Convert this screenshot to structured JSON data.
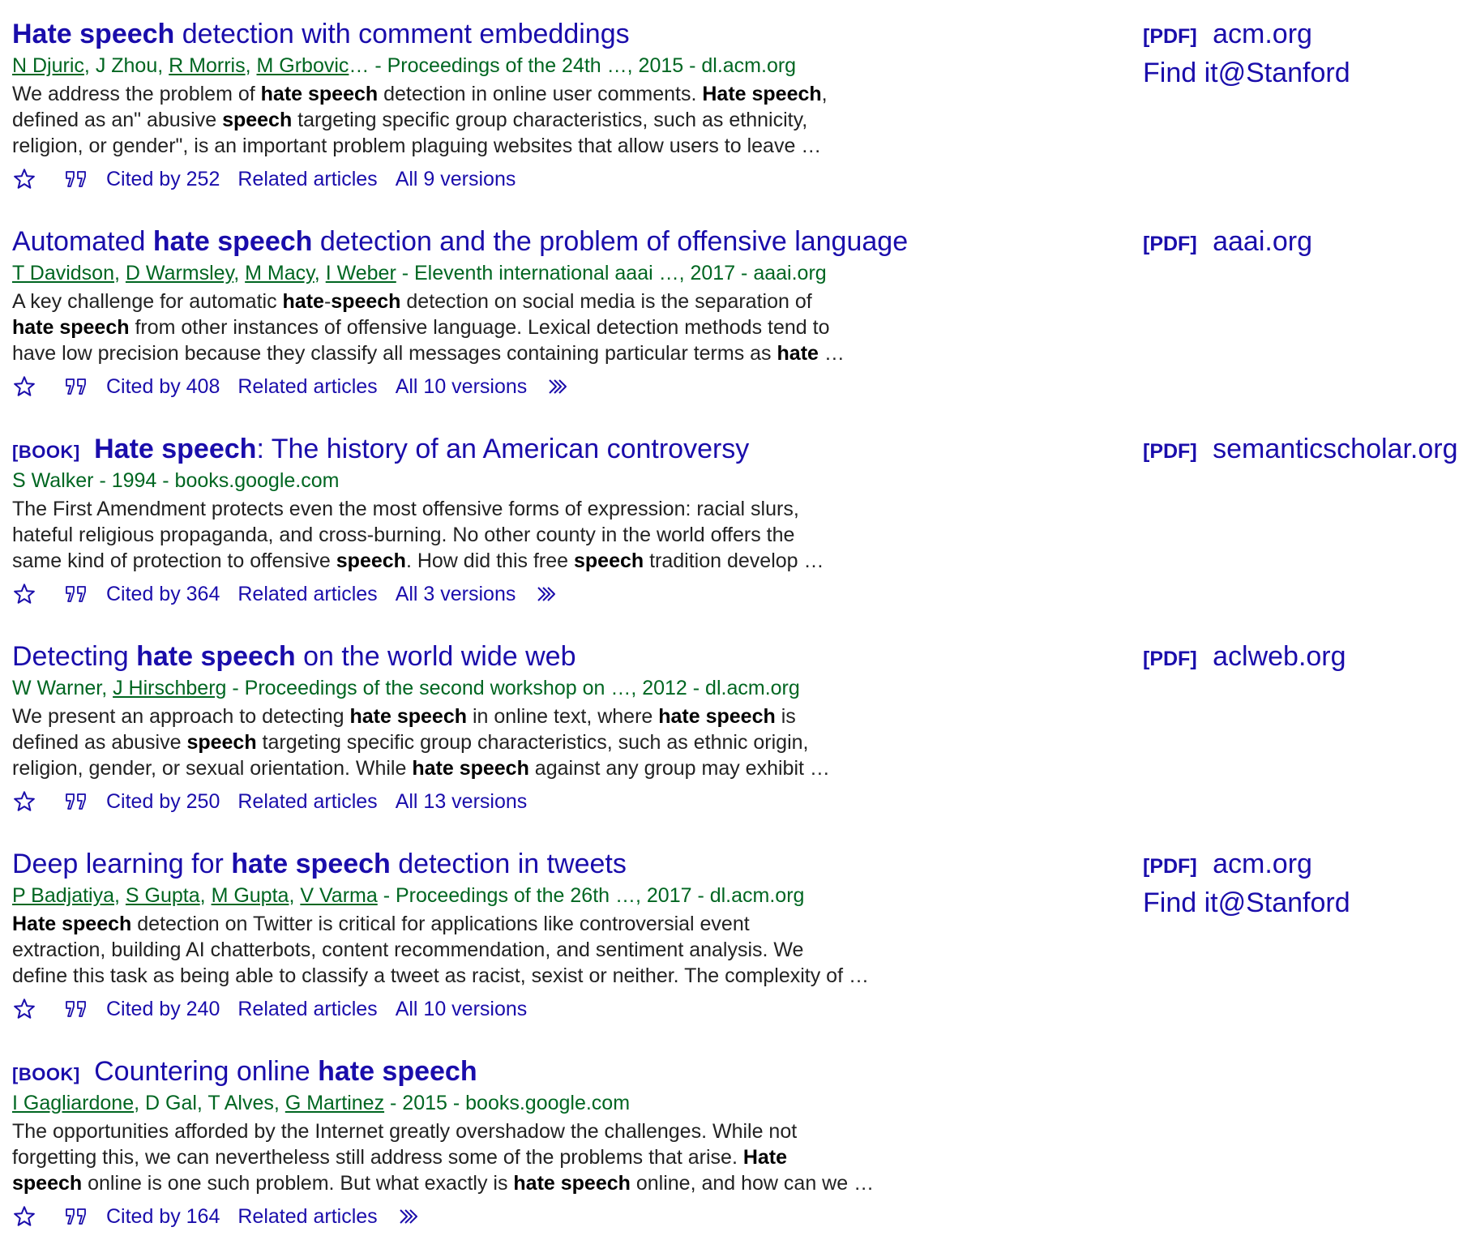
{
  "results": [
    {
      "type_tag": "",
      "title_segments": [
        {
          "text": "Hate speech",
          "bold": true
        },
        {
          "text": " detection with comment embeddings",
          "bold": false
        }
      ],
      "authors": [
        {
          "name": "N Djuric",
          "link": true
        },
        {
          "name": "J Zhou",
          "link": false
        },
        {
          "name": "R Morris",
          "link": true
        },
        {
          "name": "M Grbovic",
          "link": true
        }
      ],
      "authors_ellipsis": "…",
      "source": " - Proceedings of the 24th …, 2015 - dl.acm.org",
      "snippet_lines": [
        [
          {
            "text": "We address the problem of ",
            "bold": false
          },
          {
            "text": "hate speech",
            "bold": true
          },
          {
            "text": " detection in online user comments. ",
            "bold": false
          },
          {
            "text": "Hate speech",
            "bold": true
          },
          {
            "text": ",",
            "bold": false
          }
        ],
        [
          {
            "text": "defined as an\" abusive ",
            "bold": false
          },
          {
            "text": "speech",
            "bold": true
          },
          {
            "text": " targeting specific group characteristics, such as ethnicity,",
            "bold": false
          }
        ],
        [
          {
            "text": "religion, or gender\", is an important problem plaguing websites that allow users to leave …",
            "bold": false
          }
        ]
      ],
      "cited_by": "Cited by 252",
      "related": "Related articles",
      "versions": "All 9 versions",
      "has_more": false,
      "side": {
        "pdf_tag": "[PDF]",
        "domain": "acm.org",
        "findit": "Find it@Stanford"
      }
    },
    {
      "type_tag": "",
      "title_segments": [
        {
          "text": "Automated ",
          "bold": false
        },
        {
          "text": "hate speech",
          "bold": true
        },
        {
          "text": " detection and the problem of offensive language",
          "bold": false
        }
      ],
      "authors": [
        {
          "name": "T Davidson",
          "link": true
        },
        {
          "name": "D Warmsley",
          "link": true
        },
        {
          "name": "M Macy",
          "link": true
        },
        {
          "name": "I Weber",
          "link": true
        }
      ],
      "authors_ellipsis": "",
      "source": " - Eleventh international aaai …, 2017 - aaai.org",
      "snippet_lines": [
        [
          {
            "text": "A key challenge for automatic ",
            "bold": false
          },
          {
            "text": "hate",
            "bold": true
          },
          {
            "text": "-",
            "bold": false
          },
          {
            "text": "speech",
            "bold": true
          },
          {
            "text": " detection on social media is the separation of",
            "bold": false
          }
        ],
        [
          {
            "text": "hate speech",
            "bold": true
          },
          {
            "text": " from other instances of offensive language. Lexical detection methods tend to",
            "bold": false
          }
        ],
        [
          {
            "text": "have low precision because they classify all messages containing particular terms as ",
            "bold": false
          },
          {
            "text": "hate",
            "bold": true
          },
          {
            "text": "  …",
            "bold": false
          }
        ]
      ],
      "cited_by": "Cited by 408",
      "related": "Related articles",
      "versions": "All 10 versions",
      "has_more": true,
      "side": {
        "pdf_tag": "[PDF]",
        "domain": "aaai.org",
        "findit": ""
      }
    },
    {
      "type_tag": "[BOOK]",
      "title_segments": [
        {
          "text": "Hate speech",
          "bold": true
        },
        {
          "text": ": The history of an American controversy",
          "bold": false
        }
      ],
      "authors": [
        {
          "name": "S Walker",
          "link": false
        }
      ],
      "authors_ellipsis": "",
      "source": " - 1994 - books.google.com",
      "snippet_lines": [
        [
          {
            "text": "The First Amendment protects even the most offensive forms of expression: racial slurs,",
            "bold": false
          }
        ],
        [
          {
            "text": "hateful religious propaganda, and cross-burning. No other county in the world offers the",
            "bold": false
          }
        ],
        [
          {
            "text": "same kind of protection to offensive ",
            "bold": false
          },
          {
            "text": "speech",
            "bold": true
          },
          {
            "text": ". How did this free ",
            "bold": false
          },
          {
            "text": "speech",
            "bold": true
          },
          {
            "text": " tradition develop …",
            "bold": false
          }
        ]
      ],
      "cited_by": "Cited by 364",
      "related": "Related articles",
      "versions": "All 3 versions",
      "has_more": true,
      "side": {
        "pdf_tag": "[PDF]",
        "domain": "semanticscholar.org",
        "findit": ""
      }
    },
    {
      "type_tag": "",
      "title_segments": [
        {
          "text": "Detecting ",
          "bold": false
        },
        {
          "text": "hate speech",
          "bold": true
        },
        {
          "text": " on the world wide web",
          "bold": false
        }
      ],
      "authors": [
        {
          "name": "W Warner",
          "link": false
        },
        {
          "name": "J Hirschberg",
          "link": true
        }
      ],
      "authors_ellipsis": "",
      "source": " - Proceedings of the second workshop on …, 2012 - dl.acm.org",
      "snippet_lines": [
        [
          {
            "text": "We present an approach to detecting ",
            "bold": false
          },
          {
            "text": "hate speech",
            "bold": true
          },
          {
            "text": " in online text, where ",
            "bold": false
          },
          {
            "text": "hate speech",
            "bold": true
          },
          {
            "text": " is",
            "bold": false
          }
        ],
        [
          {
            "text": "defined as abusive ",
            "bold": false
          },
          {
            "text": "speech",
            "bold": true
          },
          {
            "text": " targeting specific group characteristics, such as ethnic origin,",
            "bold": false
          }
        ],
        [
          {
            "text": "religion, gender, or sexual orientation. While ",
            "bold": false
          },
          {
            "text": "hate speech",
            "bold": true
          },
          {
            "text": " against any group may exhibit …",
            "bold": false
          }
        ]
      ],
      "cited_by": "Cited by 250",
      "related": "Related articles",
      "versions": "All 13 versions",
      "has_more": false,
      "side": {
        "pdf_tag": "[PDF]",
        "domain": "aclweb.org",
        "findit": ""
      }
    },
    {
      "type_tag": "",
      "title_segments": [
        {
          "text": "Deep learning for ",
          "bold": false
        },
        {
          "text": "hate speech",
          "bold": true
        },
        {
          "text": " detection in tweets",
          "bold": false
        }
      ],
      "authors": [
        {
          "name": "P Badjatiya",
          "link": true
        },
        {
          "name": "S Gupta",
          "link": true
        },
        {
          "name": "M Gupta",
          "link": true
        },
        {
          "name": "V Varma",
          "link": true
        }
      ],
      "authors_ellipsis": "",
      "source": " - Proceedings of the 26th …, 2017 - dl.acm.org",
      "snippet_lines": [
        [
          {
            "text": "Hate speech",
            "bold": true
          },
          {
            "text": " detection on Twitter is critical for applications like controversial event",
            "bold": false
          }
        ],
        [
          {
            "text": "extraction, building AI chatterbots, content recommendation, and sentiment analysis. We",
            "bold": false
          }
        ],
        [
          {
            "text": "define this task as being able to classify a tweet as racist, sexist or neither. The complexity of …",
            "bold": false
          }
        ]
      ],
      "cited_by": "Cited by 240",
      "related": "Related articles",
      "versions": "All 10 versions",
      "has_more": false,
      "side": {
        "pdf_tag": "[PDF]",
        "domain": "acm.org",
        "findit": "Find it@Stanford"
      }
    },
    {
      "type_tag": "[BOOK]",
      "title_segments": [
        {
          "text": "Countering online ",
          "bold": false
        },
        {
          "text": "hate speech",
          "bold": true
        }
      ],
      "authors": [
        {
          "name": "I Gagliardone",
          "link": true
        },
        {
          "name": "D Gal",
          "link": false
        },
        {
          "name": "T Alves",
          "link": false
        },
        {
          "name": "G Martinez",
          "link": true
        }
      ],
      "authors_ellipsis": "",
      "source": " - 2015 - books.google.com",
      "snippet_lines": [
        [
          {
            "text": "The opportunities afforded by the Internet greatly overshadow the challenges. While not",
            "bold": false
          }
        ],
        [
          {
            "text": "forgetting this, we can nevertheless still address some of the problems that arise. ",
            "bold": false
          },
          {
            "text": "Hate",
            "bold": true
          }
        ],
        [
          {
            "text": "speech",
            "bold": true
          },
          {
            "text": " online is one such problem. But what exactly is ",
            "bold": false
          },
          {
            "text": "hate speech",
            "bold": true
          },
          {
            "text": " online, and how can we …",
            "bold": false
          }
        ]
      ],
      "cited_by": "Cited by 164",
      "related": "Related articles",
      "versions": "",
      "has_more": true,
      "side": {
        "pdf_tag": "",
        "domain": "",
        "findit": ""
      }
    }
  ],
  "icons": {
    "save": "star-icon",
    "cite": "quote-icon",
    "more": "double-chevron-icon"
  },
  "colors": {
    "link": "#1a0dab",
    "meta": "#006621",
    "text": "#222222"
  }
}
